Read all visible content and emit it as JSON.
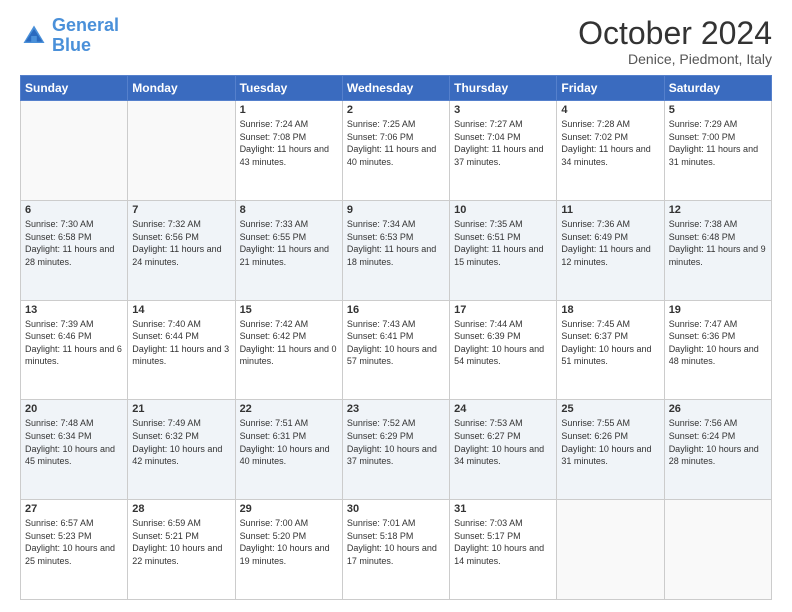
{
  "header": {
    "logo_line1": "General",
    "logo_line2": "Blue",
    "month": "October 2024",
    "location": "Denice, Piedmont, Italy"
  },
  "weekdays": [
    "Sunday",
    "Monday",
    "Tuesday",
    "Wednesday",
    "Thursday",
    "Friday",
    "Saturday"
  ],
  "weeks": [
    [
      {
        "day": "",
        "sunrise": "",
        "sunset": "",
        "daylight": "",
        "empty": true
      },
      {
        "day": "",
        "sunrise": "",
        "sunset": "",
        "daylight": "",
        "empty": true
      },
      {
        "day": "1",
        "sunrise": "Sunrise: 7:24 AM",
        "sunset": "Sunset: 7:08 PM",
        "daylight": "Daylight: 11 hours and 43 minutes.",
        "empty": false
      },
      {
        "day": "2",
        "sunrise": "Sunrise: 7:25 AM",
        "sunset": "Sunset: 7:06 PM",
        "daylight": "Daylight: 11 hours and 40 minutes.",
        "empty": false
      },
      {
        "day": "3",
        "sunrise": "Sunrise: 7:27 AM",
        "sunset": "Sunset: 7:04 PM",
        "daylight": "Daylight: 11 hours and 37 minutes.",
        "empty": false
      },
      {
        "day": "4",
        "sunrise": "Sunrise: 7:28 AM",
        "sunset": "Sunset: 7:02 PM",
        "daylight": "Daylight: 11 hours and 34 minutes.",
        "empty": false
      },
      {
        "day": "5",
        "sunrise": "Sunrise: 7:29 AM",
        "sunset": "Sunset: 7:00 PM",
        "daylight": "Daylight: 11 hours and 31 minutes.",
        "empty": false
      }
    ],
    [
      {
        "day": "6",
        "sunrise": "Sunrise: 7:30 AM",
        "sunset": "Sunset: 6:58 PM",
        "daylight": "Daylight: 11 hours and 28 minutes.",
        "empty": false
      },
      {
        "day": "7",
        "sunrise": "Sunrise: 7:32 AM",
        "sunset": "Sunset: 6:56 PM",
        "daylight": "Daylight: 11 hours and 24 minutes.",
        "empty": false
      },
      {
        "day": "8",
        "sunrise": "Sunrise: 7:33 AM",
        "sunset": "Sunset: 6:55 PM",
        "daylight": "Daylight: 11 hours and 21 minutes.",
        "empty": false
      },
      {
        "day": "9",
        "sunrise": "Sunrise: 7:34 AM",
        "sunset": "Sunset: 6:53 PM",
        "daylight": "Daylight: 11 hours and 18 minutes.",
        "empty": false
      },
      {
        "day": "10",
        "sunrise": "Sunrise: 7:35 AM",
        "sunset": "Sunset: 6:51 PM",
        "daylight": "Daylight: 11 hours and 15 minutes.",
        "empty": false
      },
      {
        "day": "11",
        "sunrise": "Sunrise: 7:36 AM",
        "sunset": "Sunset: 6:49 PM",
        "daylight": "Daylight: 11 hours and 12 minutes.",
        "empty": false
      },
      {
        "day": "12",
        "sunrise": "Sunrise: 7:38 AM",
        "sunset": "Sunset: 6:48 PM",
        "daylight": "Daylight: 11 hours and 9 minutes.",
        "empty": false
      }
    ],
    [
      {
        "day": "13",
        "sunrise": "Sunrise: 7:39 AM",
        "sunset": "Sunset: 6:46 PM",
        "daylight": "Daylight: 11 hours and 6 minutes.",
        "empty": false
      },
      {
        "day": "14",
        "sunrise": "Sunrise: 7:40 AM",
        "sunset": "Sunset: 6:44 PM",
        "daylight": "Daylight: 11 hours and 3 minutes.",
        "empty": false
      },
      {
        "day": "15",
        "sunrise": "Sunrise: 7:42 AM",
        "sunset": "Sunset: 6:42 PM",
        "daylight": "Daylight: 11 hours and 0 minutes.",
        "empty": false
      },
      {
        "day": "16",
        "sunrise": "Sunrise: 7:43 AM",
        "sunset": "Sunset: 6:41 PM",
        "daylight": "Daylight: 10 hours and 57 minutes.",
        "empty": false
      },
      {
        "day": "17",
        "sunrise": "Sunrise: 7:44 AM",
        "sunset": "Sunset: 6:39 PM",
        "daylight": "Daylight: 10 hours and 54 minutes.",
        "empty": false
      },
      {
        "day": "18",
        "sunrise": "Sunrise: 7:45 AM",
        "sunset": "Sunset: 6:37 PM",
        "daylight": "Daylight: 10 hours and 51 minutes.",
        "empty": false
      },
      {
        "day": "19",
        "sunrise": "Sunrise: 7:47 AM",
        "sunset": "Sunset: 6:36 PM",
        "daylight": "Daylight: 10 hours and 48 minutes.",
        "empty": false
      }
    ],
    [
      {
        "day": "20",
        "sunrise": "Sunrise: 7:48 AM",
        "sunset": "Sunset: 6:34 PM",
        "daylight": "Daylight: 10 hours and 45 minutes.",
        "empty": false
      },
      {
        "day": "21",
        "sunrise": "Sunrise: 7:49 AM",
        "sunset": "Sunset: 6:32 PM",
        "daylight": "Daylight: 10 hours and 42 minutes.",
        "empty": false
      },
      {
        "day": "22",
        "sunrise": "Sunrise: 7:51 AM",
        "sunset": "Sunset: 6:31 PM",
        "daylight": "Daylight: 10 hours and 40 minutes.",
        "empty": false
      },
      {
        "day": "23",
        "sunrise": "Sunrise: 7:52 AM",
        "sunset": "Sunset: 6:29 PM",
        "daylight": "Daylight: 10 hours and 37 minutes.",
        "empty": false
      },
      {
        "day": "24",
        "sunrise": "Sunrise: 7:53 AM",
        "sunset": "Sunset: 6:27 PM",
        "daylight": "Daylight: 10 hours and 34 minutes.",
        "empty": false
      },
      {
        "day": "25",
        "sunrise": "Sunrise: 7:55 AM",
        "sunset": "Sunset: 6:26 PM",
        "daylight": "Daylight: 10 hours and 31 minutes.",
        "empty": false
      },
      {
        "day": "26",
        "sunrise": "Sunrise: 7:56 AM",
        "sunset": "Sunset: 6:24 PM",
        "daylight": "Daylight: 10 hours and 28 minutes.",
        "empty": false
      }
    ],
    [
      {
        "day": "27",
        "sunrise": "Sunrise: 6:57 AM",
        "sunset": "Sunset: 5:23 PM",
        "daylight": "Daylight: 10 hours and 25 minutes.",
        "empty": false
      },
      {
        "day": "28",
        "sunrise": "Sunrise: 6:59 AM",
        "sunset": "Sunset: 5:21 PM",
        "daylight": "Daylight: 10 hours and 22 minutes.",
        "empty": false
      },
      {
        "day": "29",
        "sunrise": "Sunrise: 7:00 AM",
        "sunset": "Sunset: 5:20 PM",
        "daylight": "Daylight: 10 hours and 19 minutes.",
        "empty": false
      },
      {
        "day": "30",
        "sunrise": "Sunrise: 7:01 AM",
        "sunset": "Sunset: 5:18 PM",
        "daylight": "Daylight: 10 hours and 17 minutes.",
        "empty": false
      },
      {
        "day": "31",
        "sunrise": "Sunrise: 7:03 AM",
        "sunset": "Sunset: 5:17 PM",
        "daylight": "Daylight: 10 hours and 14 minutes.",
        "empty": false
      },
      {
        "day": "",
        "sunrise": "",
        "sunset": "",
        "daylight": "",
        "empty": true
      },
      {
        "day": "",
        "sunrise": "",
        "sunset": "",
        "daylight": "",
        "empty": true
      }
    ]
  ]
}
